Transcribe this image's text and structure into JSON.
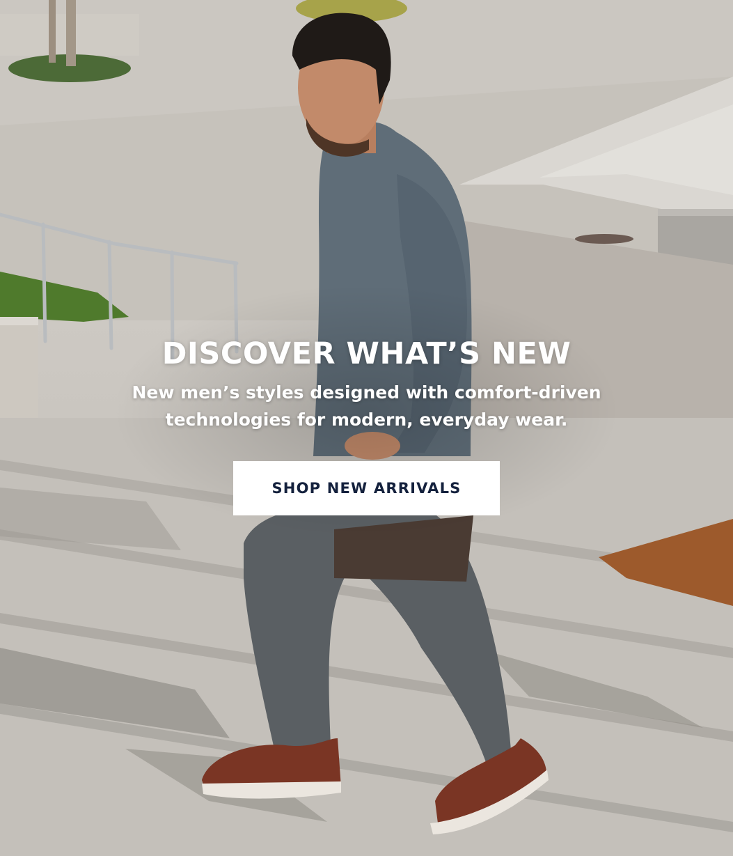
{
  "hero": {
    "headline": "DISCOVER WHAT’S NEW",
    "subhead": "New men’s styles designed with comfort-driven technologies for modern, everyday wear.",
    "cta_label": "SHOP NEW ARRIVALS"
  },
  "colors": {
    "headline_text": "#ffffff",
    "cta_background": "#ffffff",
    "cta_text": "#14213d"
  },
  "image": {
    "subject": "man-walking-up-steps-in-brown-shoes"
  }
}
